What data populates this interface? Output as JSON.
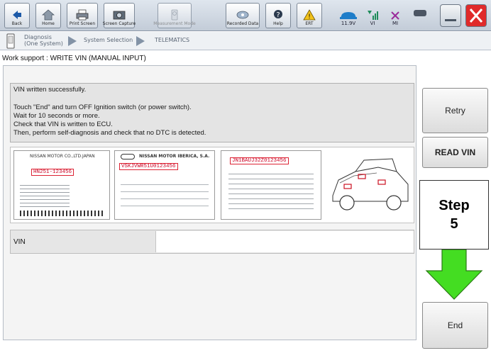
{
  "toolbar": {
    "back_label": "Back",
    "home_label": "Home",
    "print_label": "Print Screen",
    "capture_label": "Screen Capture",
    "measurement_label": "Measurement Mode",
    "recorded_label": "Recorded Data",
    "help_label": "Help",
    "status_voltage": "11.9V",
    "status_vi": "VI",
    "status_mi": "MI"
  },
  "breadcrumb": {
    "items": [
      "Diagnosis (One System)",
      "System Selection",
      "TELEMATICS"
    ]
  },
  "page_title": "Work support : WRITE VIN (MANUAL INPUT)",
  "message": {
    "line1": "VIN written successfully.",
    "line2": "Touch \"End\" and turn OFF Ignition switch (or power switch).",
    "line3": "Wait for 10 seconds or more.",
    "line4": "Check that VIN is written to ECU.",
    "line5": "Then, perform self-diagnosis and check that no DTC is detected."
  },
  "vin_plates": {
    "plate1_maker": "NISSAN MOTOR CO.,LTD.JAPAN",
    "plate1_vin": "HN251-123456",
    "plate2_maker": "NISSAN MOTOR IBERICA, S.A.",
    "plate2_vin": "VSKJVWR51U0123456",
    "plate3_vin": "JN1BAUJ32Z0123456"
  },
  "vin_field": {
    "label": "VIN",
    "value": ""
  },
  "buttons": {
    "retry": "Retry",
    "read_vin": "READ VIN",
    "end": "End"
  },
  "annotation": {
    "step_word": "Step",
    "step_number": "5",
    "arrow_color": "#44dd22"
  },
  "colors": {
    "close_red": "#e02a2a",
    "vin_red": "#cc1122"
  }
}
